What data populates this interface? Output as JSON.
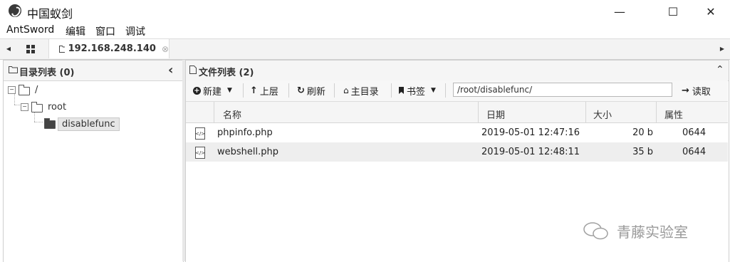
{
  "window": {
    "title": "中国蚁剑",
    "minimize": "—",
    "maximize": "☐",
    "close": "✕"
  },
  "menu": [
    "AntSword",
    "编辑",
    "窗口",
    "调试"
  ],
  "tabs": {
    "host_label": "192.168.248.140",
    "close_glyph": "⊗"
  },
  "left_panel": {
    "title": "目录列表 (0)",
    "collapse_glyph": "‹",
    "tree": [
      {
        "label": "/",
        "toggle": "−"
      },
      {
        "label": "root",
        "toggle": "−"
      },
      {
        "label": "disablefunc"
      }
    ]
  },
  "right_panel": {
    "title": "文件列表 (2)",
    "collapse_glyph": "⌃",
    "toolbar": {
      "new_label": "新建",
      "up_label": "上层",
      "refresh_label": "刷新",
      "home_label": "主目录",
      "bookmark_label": "书签",
      "path_value": "/root/disablefunc/",
      "read_label": "读取"
    },
    "columns": {
      "name": "名称",
      "date": "日期",
      "size": "大小",
      "attr": "属性"
    },
    "files": [
      {
        "name": "phpinfo.php",
        "date": "2019-05-01 12:47:16",
        "size": "20 b",
        "attr": "0644"
      },
      {
        "name": "webshell.php",
        "date": "2019-05-01 12:48:11",
        "size": "35 b",
        "attr": "0644"
      }
    ]
  },
  "watermark": "青藤实验室",
  "colors": {
    "selected_row": "#eeeeee",
    "tree_selected": "#e6e6e6",
    "panel_header": "#f5f5f5"
  }
}
